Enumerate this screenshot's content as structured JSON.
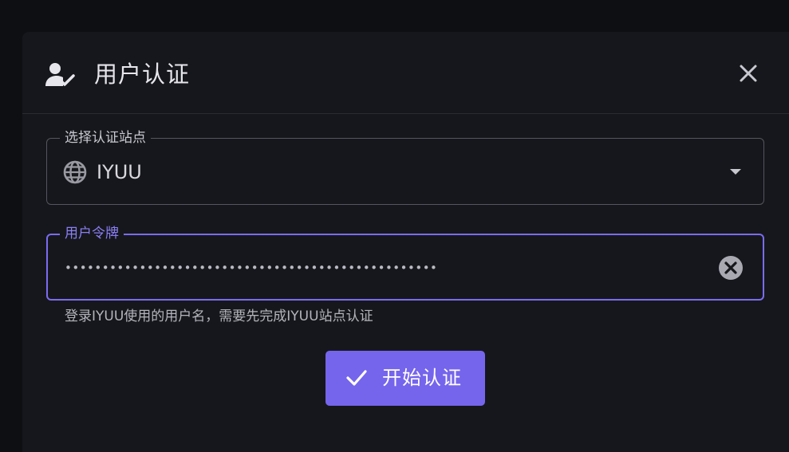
{
  "dialog": {
    "title": "用户认证",
    "header_icon": "user-check-icon",
    "close_icon": "close-icon"
  },
  "site_select": {
    "label": "选择认证站点",
    "value": "IYUU",
    "icon": "globe-icon",
    "dropdown_icon": "chevron-down-icon"
  },
  "token_field": {
    "label": "用户令牌",
    "value": "••••••••••••••••••••••••••••••••••••••••••••••••••",
    "clear_icon": "clear-icon",
    "hint": "登录IYUU使用的用户名，需要先完成IYUU站点认证"
  },
  "submit": {
    "label": "开始认证",
    "icon": "check-icon"
  },
  "colors": {
    "accent": "#7565ec",
    "focus_border": "#7b6cf0",
    "background": "#16171c"
  }
}
